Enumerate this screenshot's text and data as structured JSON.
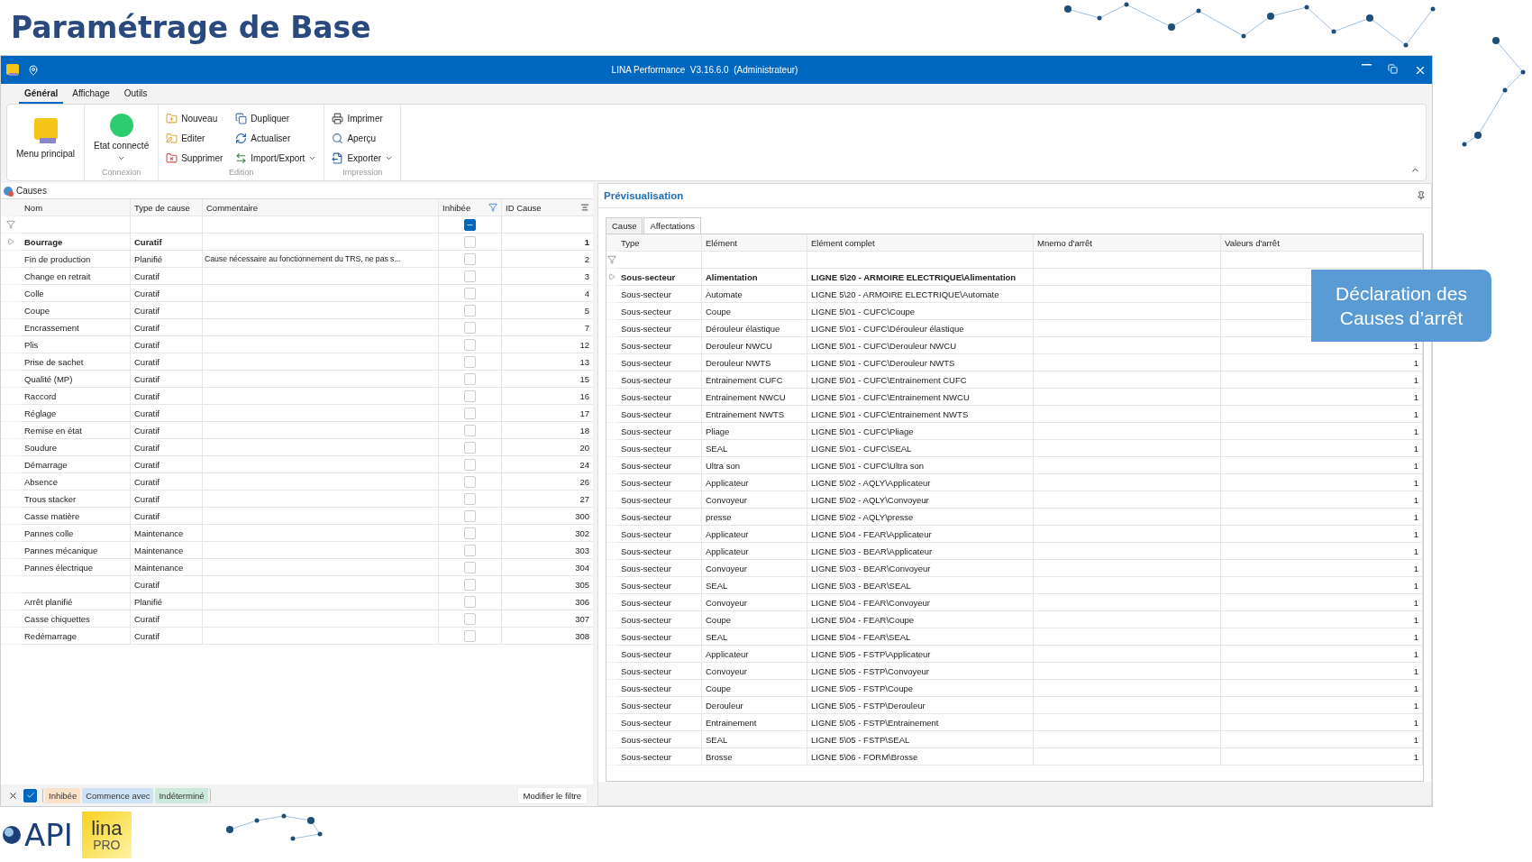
{
  "slide": {
    "title": "Paramétrage de Base",
    "callout": "Déclaration des Causes d’arrêt",
    "logos": {
      "api": "API",
      "lina": "lina",
      "pro": "PRO"
    }
  },
  "window": {
    "title": "LINA Performance  V3.16.6.0  (Administrateur)"
  },
  "ribbon": {
    "tabs": [
      {
        "label": "Général",
        "selected": true
      },
      {
        "label": "Affichage",
        "selected": false
      },
      {
        "label": "Outils",
        "selected": false
      }
    ],
    "groups": [
      {
        "items": [
          {
            "kind": "large",
            "label": "Menu principal"
          }
        ]
      },
      {
        "label": "Connexion",
        "items": [
          {
            "kind": "status",
            "label": "Etat connecté",
            "color": "#2ecc71",
            "dropdown": true
          }
        ]
      },
      {
        "label": "Edition",
        "items": [
          {
            "kind": "small",
            "label": "Nouveau"
          },
          {
            "kind": "small",
            "label": "Editer"
          },
          {
            "kind": "small",
            "label": "Supprimer"
          },
          {
            "kind": "small",
            "label": "Dupliquer"
          },
          {
            "kind": "small",
            "label": "Actualiser"
          },
          {
            "kind": "small",
            "label": "Import/Export",
            "dropdown": true
          }
        ]
      },
      {
        "label": "Impression",
        "items": [
          {
            "kind": "small",
            "label": "Imprimer"
          },
          {
            "kind": "small",
            "label": "Aperçu"
          },
          {
            "kind": "small",
            "label": "Exporter",
            "dropdown": true
          }
        ]
      }
    ]
  },
  "causes": {
    "title": "Causes",
    "columns": [
      "Nom",
      "Type de cause",
      "Commentaire",
      "Inhibée",
      "ID Cause"
    ],
    "inhibee_filter_indeterminate": true,
    "rows": [
      {
        "nom": "Bourrage",
        "type": "Curatif",
        "inhibee": false,
        "id": "1",
        "selected": true
      },
      {
        "nom": "Fin de production",
        "type": "Planifié",
        "commentaire": "Cause nécessaire au fonctionnement du TRS, ne pas s...",
        "inhibee": false,
        "id": "2",
        "selected": false
      },
      {
        "nom": "Change en retrait",
        "type": "Curatif",
        "inhibee": false,
        "id": "3",
        "selected": false
      },
      {
        "nom": "Colle",
        "type": "Curatif",
        "inhibee": false,
        "id": "4",
        "selected": false
      },
      {
        "nom": "Coupe",
        "type": "Curatif",
        "inhibee": false,
        "id": "5",
        "selected": false
      },
      {
        "nom": "Encrassement",
        "type": "Curatif",
        "inhibee": false,
        "id": "7",
        "selected": false
      },
      {
        "nom": "Plis",
        "type": "Curatif",
        "inhibee": false,
        "id": "12",
        "selected": false
      },
      {
        "nom": "Prise de sachet",
        "type": "Curatif",
        "inhibee": false,
        "id": "13",
        "selected": false
      },
      {
        "nom": "Qualité (MP)",
        "type": "Curatif",
        "inhibee": false,
        "id": "15",
        "selected": false
      },
      {
        "nom": "Raccord",
        "type": "Curatif",
        "inhibee": false,
        "id": "16",
        "selected": false
      },
      {
        "nom": "Réglage",
        "type": "Curatif",
        "inhibee": false,
        "id": "17",
        "selected": false
      },
      {
        "nom": "Remise en état",
        "type": "Curatif",
        "inhibee": false,
        "id": "18",
        "selected": false
      },
      {
        "nom": "Soudure",
        "type": "Curatif",
        "inhibee": false,
        "id": "20",
        "selected": false
      },
      {
        "nom": "Démarrage",
        "type": "Curatif",
        "inhibee": false,
        "id": "24",
        "selected": false
      },
      {
        "nom": "Absence",
        "type": "Curatif",
        "inhibee": false,
        "id": "26",
        "selected": false
      },
      {
        "nom": "Trous stacker",
        "type": "Curatif",
        "inhibee": false,
        "id": "27",
        "selected": false
      },
      {
        "nom": "Casse matière",
        "type": "Curatif",
        "inhibee": false,
        "id": "300",
        "selected": false
      },
      {
        "nom": "Pannes colle",
        "type": "Maintenance",
        "inhibee": false,
        "id": "302",
        "selected": false
      },
      {
        "nom": "Pannes mécanique",
        "type": "Maintenance",
        "inhibee": false,
        "id": "303",
        "selected": false
      },
      {
        "nom": "Pannes électrique",
        "type": "Maintenance",
        "inhibee": false,
        "id": "304",
        "selected": false
      },
      {
        "type": "Curatif",
        "inhibee": false,
        "id": "305",
        "selected": false
      },
      {
        "nom": "Arrêt planifié",
        "type": "Planifié",
        "inhibee": false,
        "id": "306",
        "selected": false
      },
      {
        "nom": "Casse chiquettes",
        "type": "Curatif",
        "inhibee": false,
        "id": "307",
        "selected": false
      },
      {
        "nom": "Redémarrage",
        "type": "Curatif",
        "inhibee": false,
        "id": "308",
        "selected": false
      }
    ],
    "filter_bar": {
      "enabled": true,
      "chips": [
        {
          "label": "Inhibée",
          "color": "#fbe1c8"
        },
        {
          "label": "Commence avec",
          "color": "#cde2f5"
        },
        {
          "label": "Indéterminé",
          "color": "#cce9dc"
        }
      ],
      "button": "Modifier le filtre"
    }
  },
  "preview": {
    "title": "Prévisualisation",
    "tabs": [
      {
        "label": "Cause",
        "selected": false
      },
      {
        "label": "Affectations",
        "selected": true
      }
    ],
    "columns": [
      "Type",
      "Elément",
      "Elément complet",
      "Mnemo d'arrêt",
      "Valeurs d'arrêt"
    ],
    "rows": [
      {
        "type": "Sous-secteur",
        "element": "Alimentation",
        "complet": "LIGNE 5\\20 - ARMOIRE ELECTRIQUE\\Alimentation",
        "selected": true
      },
      {
        "type": "Sous-secteur",
        "element": "Automate",
        "complet": "LIGNE 5\\20 - ARMOIRE ELECTRIQUE\\Automate",
        "selected": false
      },
      {
        "type": "Sous-secteur",
        "element": "Coupe",
        "complet": "LIGNE 5\\01 - CUFC\\Coupe",
        "selected": false
      },
      {
        "type": "Sous-secteur",
        "element": "Dérouleur élastique",
        "complet": "LIGNE 5\\01 - CUFC\\Dérouleur élastique",
        "selected": false
      },
      {
        "type": "Sous-secteur",
        "element": "Derouleur NWCU",
        "complet": "LIGNE 5\\01 - CUFC\\Derouleur NWCU",
        "valeur": "1",
        "selected": false
      },
      {
        "type": "Sous-secteur",
        "element": "Derouleur NWTS",
        "complet": "LIGNE 5\\01 - CUFC\\Derouleur NWTS",
        "valeur": "1",
        "selected": false
      },
      {
        "type": "Sous-secteur",
        "element": "Entrainement  CUFC",
        "complet": "LIGNE 5\\01 - CUFC\\Entrainement  CUFC",
        "valeur": "1",
        "selected": false
      },
      {
        "type": "Sous-secteur",
        "element": "Entrainement  NWCU",
        "complet": "LIGNE 5\\01 - CUFC\\Entrainement  NWCU",
        "valeur": "1",
        "selected": false
      },
      {
        "type": "Sous-secteur",
        "element": "Entrainement NWTS",
        "complet": "LIGNE 5\\01 - CUFC\\Entrainement NWTS",
        "valeur": "1",
        "selected": false
      },
      {
        "type": "Sous-secteur",
        "element": "Pliage",
        "complet": "LIGNE 5\\01 - CUFC\\Pliage",
        "valeur": "1",
        "selected": false
      },
      {
        "type": "Sous-secteur",
        "element": "SEAL",
        "complet": "LIGNE 5\\01 - CUFC\\SEAL",
        "valeur": "1",
        "selected": false
      },
      {
        "type": "Sous-secteur",
        "element": "Ultra son",
        "complet": "LIGNE 5\\01 - CUFC\\Ultra son",
        "valeur": "1",
        "selected": false
      },
      {
        "type": "Sous-secteur",
        "element": "Applicateur",
        "complet": "LIGNE 5\\02 - AQLY\\Applicateur",
        "valeur": "1",
        "selected": false
      },
      {
        "type": "Sous-secteur",
        "element": "Convoyeur",
        "complet": "LIGNE 5\\02 - AQLY\\Convoyeur",
        "valeur": "1",
        "selected": false
      },
      {
        "type": "Sous-secteur",
        "element": "presse",
        "complet": "LIGNE 5\\02 - AQLY\\presse",
        "valeur": "1",
        "selected": false
      },
      {
        "type": "Sous-secteur",
        "element": "Applicateur",
        "complet": "LIGNE 5\\04 - FEAR\\Applicateur",
        "valeur": "1",
        "selected": false
      },
      {
        "type": "Sous-secteur",
        "element": "Applicateur",
        "complet": "LIGNE 5\\03 - BEAR\\Applicateur",
        "valeur": "1",
        "selected": false
      },
      {
        "type": "Sous-secteur",
        "element": "Convoyeur",
        "complet": "LIGNE 5\\03 - BEAR\\Convoyeur",
        "valeur": "1",
        "selected": false
      },
      {
        "type": "Sous-secteur",
        "element": "SEAL",
        "complet": "LIGNE 5\\03 - BEAR\\SEAL",
        "valeur": "1",
        "selected": false
      },
      {
        "type": "Sous-secteur",
        "element": "Convoyeur",
        "complet": "LIGNE 5\\04 - FEAR\\Convoyeur",
        "valeur": "1",
        "selected": false
      },
      {
        "type": "Sous-secteur",
        "element": "Coupe",
        "complet": "LIGNE 5\\04 - FEAR\\Coupe",
        "valeur": "1",
        "selected": false
      },
      {
        "type": "Sous-secteur",
        "element": "SEAL",
        "complet": "LIGNE 5\\04 - FEAR\\SEAL",
        "valeur": "1",
        "selected": false
      },
      {
        "type": "Sous-secteur",
        "element": "Applicateur",
        "complet": "LIGNE 5\\05 - FSTP\\Applicateur",
        "valeur": "1",
        "selected": false
      },
      {
        "type": "Sous-secteur",
        "element": "Convoyeur",
        "complet": "LIGNE 5\\05 - FSTP\\Convoyeur",
        "valeur": "1",
        "selected": false
      },
      {
        "type": "Sous-secteur",
        "element": "Coupe",
        "complet": "LIGNE 5\\05 - FSTP\\Coupe",
        "valeur": "1",
        "selected": false
      },
      {
        "type": "Sous-secteur",
        "element": "Derouleur",
        "complet": "LIGNE 5\\05 - FSTP\\Derouleur",
        "valeur": "1",
        "selected": false
      },
      {
        "type": "Sous-secteur",
        "element": "Entrainement",
        "complet": "LIGNE 5\\05 - FSTP\\Entrainement",
        "valeur": "1",
        "selected": false
      },
      {
        "type": "Sous-secteur",
        "element": "SEAL",
        "complet": "LIGNE 5\\05 - FSTP\\SEAL",
        "valeur": "1",
        "selected": false
      },
      {
        "type": "Sous-secteur",
        "element": "Brosse",
        "complet": "LIGNE 5\\06 - FORM\\Brosse",
        "valeur": "1",
        "selected": false
      }
    ]
  }
}
